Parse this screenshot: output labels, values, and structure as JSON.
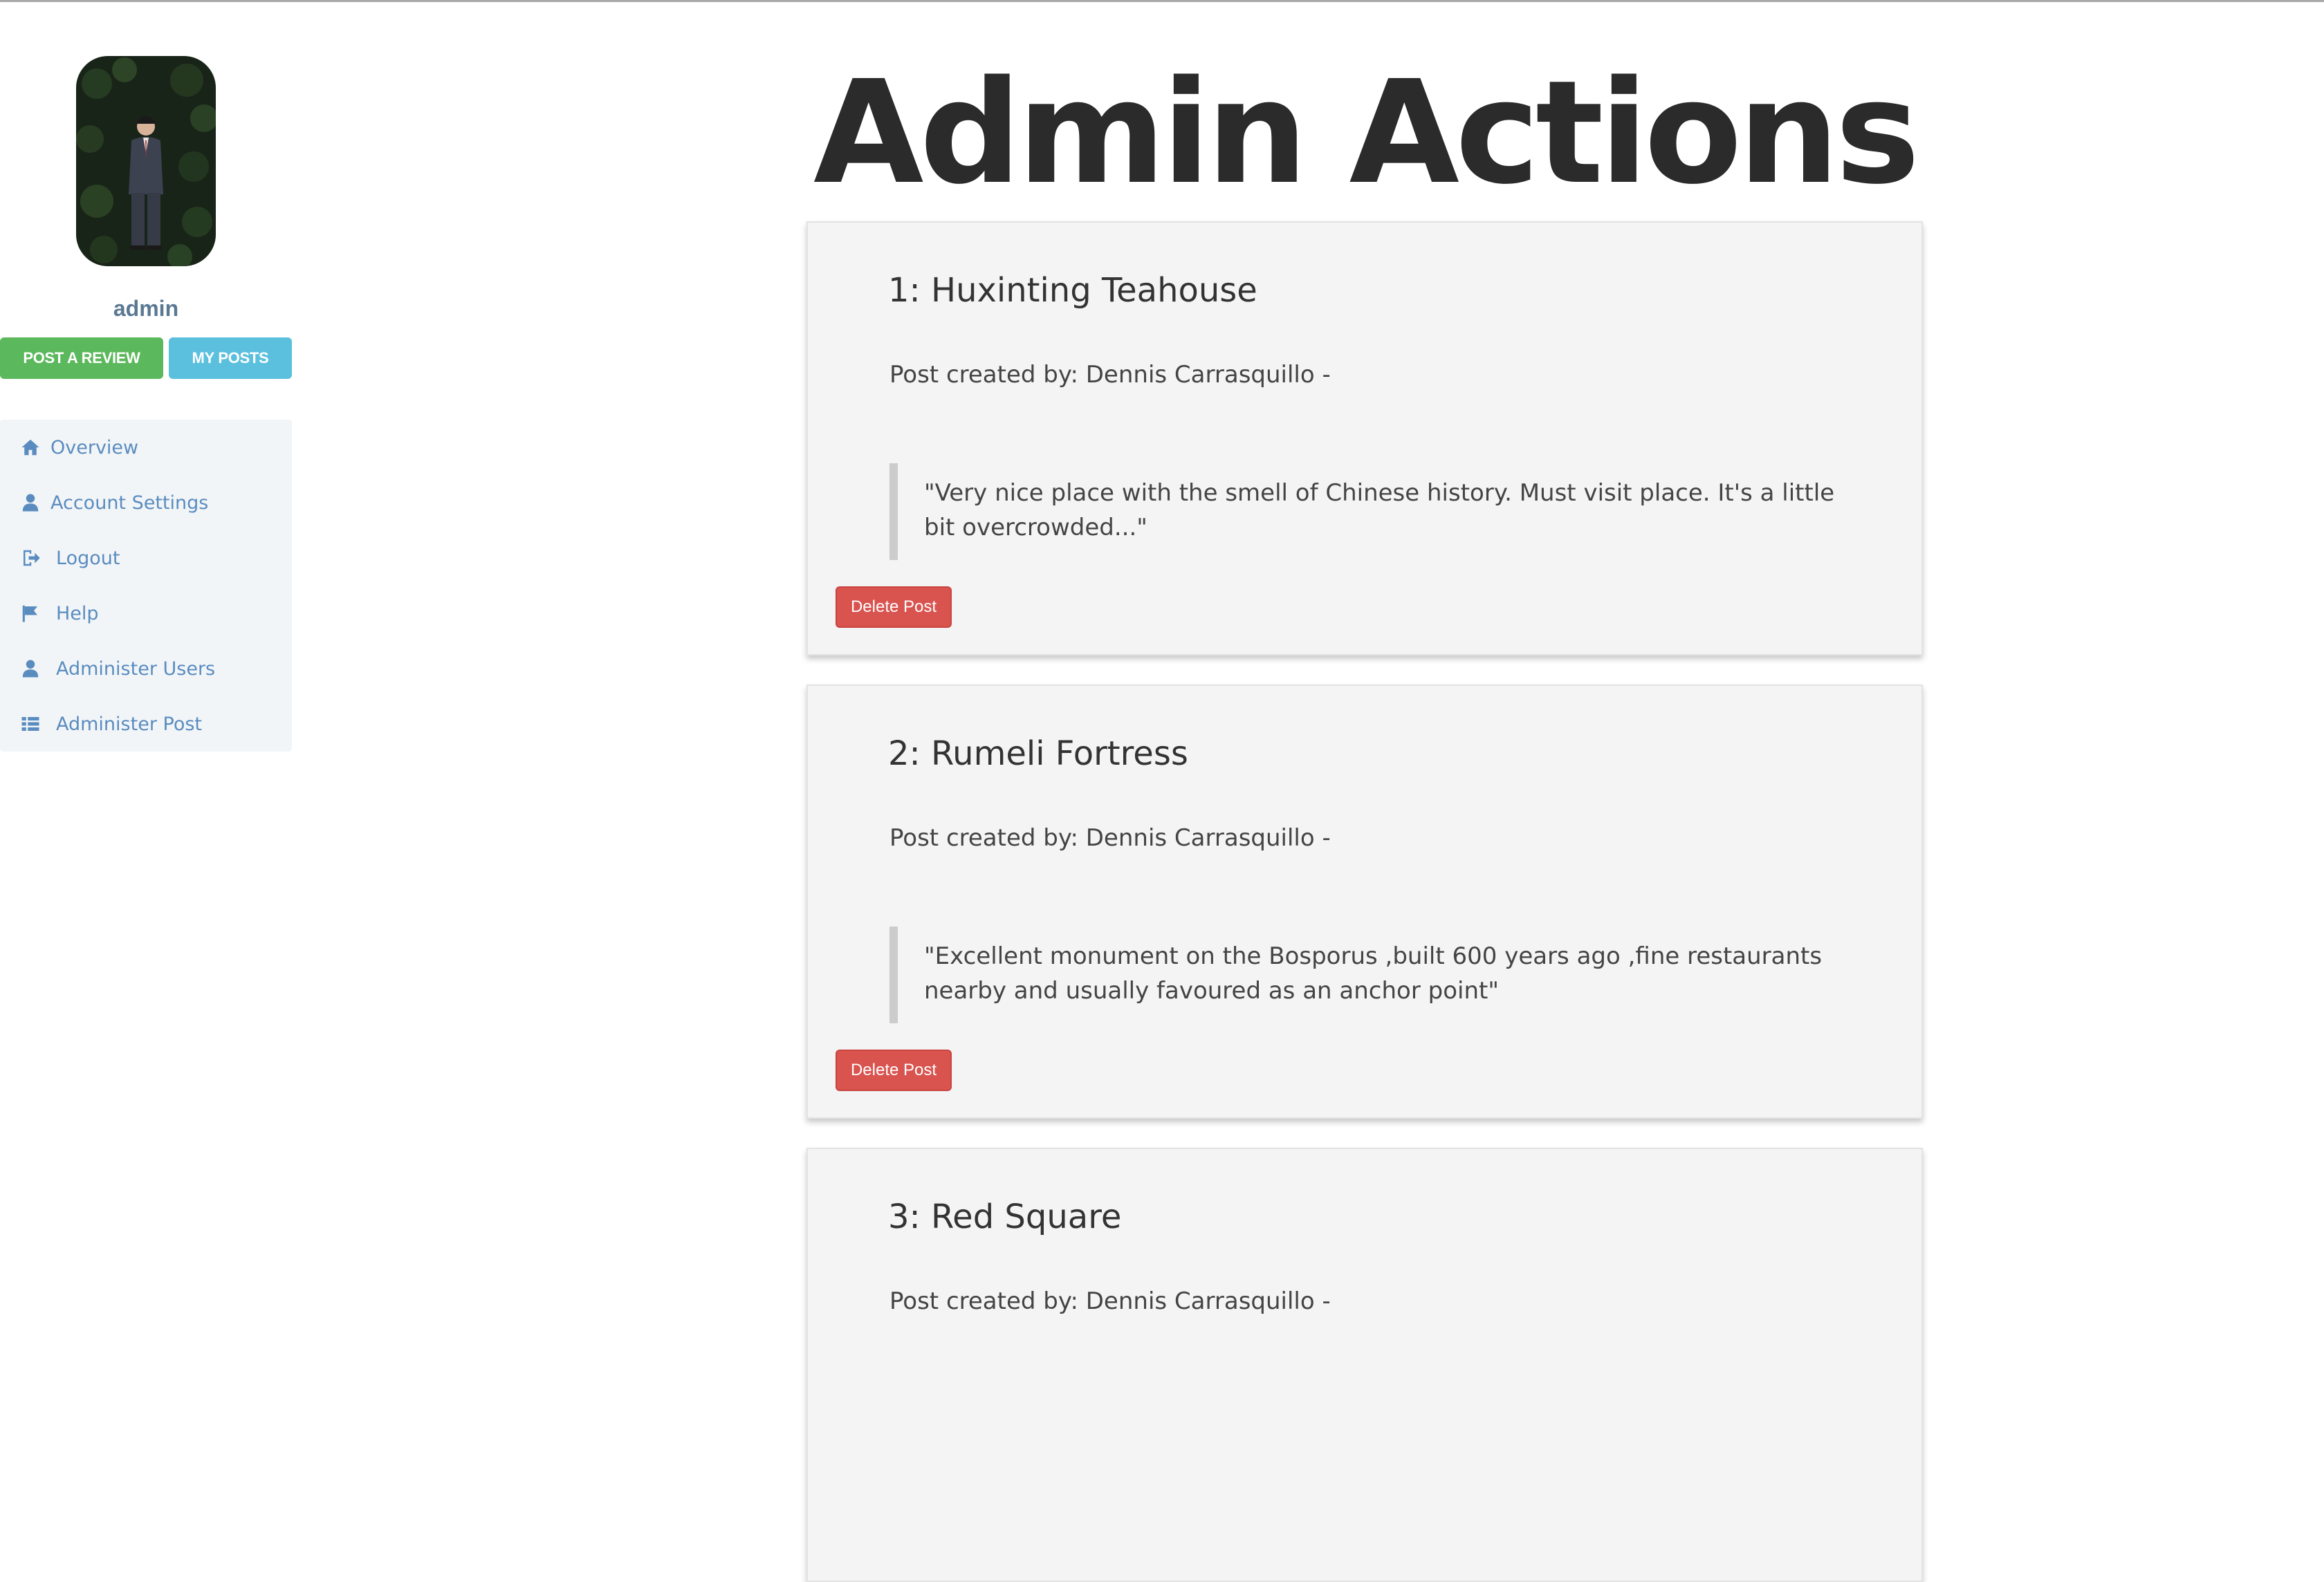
{
  "sidebar": {
    "avatar_alt": "admin profile photo",
    "username": "admin",
    "buttons": {
      "post_review": "POST A REVIEW",
      "my_posts": "MY POSTS"
    },
    "menu": [
      {
        "label": "Overview",
        "icon": "home-icon"
      },
      {
        "label": "Account Settings",
        "icon": "user-icon"
      },
      {
        "label": "Logout",
        "icon": "logout-icon"
      },
      {
        "label": "Help",
        "icon": "flag-icon"
      },
      {
        "label": "Administer Users",
        "icon": "user-icon"
      },
      {
        "label": "Administer Post",
        "icon": "list-icon"
      }
    ]
  },
  "main": {
    "title": "Admin Actions",
    "delete_label": "Delete Post",
    "posts": [
      {
        "title": "1: Huxinting Teahouse",
        "author": "Post created by: Dennis Carrasquillo -",
        "quote": "\"Very nice place with the smell of Chinese history. Must visit place. It's a little bit overcrowded...\""
      },
      {
        "title": "2: Rumeli Fortress",
        "author": "Post created by: Dennis Carrasquillo -",
        "quote": "\"Excellent monument on the Bosporus ,built 600 years ago ,fine restaurants nearby and usually favoured as an anchor point\""
      },
      {
        "title": "3: Red Square",
        "author": "Post created by: Dennis Carrasquillo -",
        "quote": ""
      }
    ]
  },
  "colors": {
    "success": "#5cb85c",
    "info": "#5bc0de",
    "danger": "#d9534f",
    "link": "#5a8cbf",
    "title": "#2b2b2b"
  }
}
